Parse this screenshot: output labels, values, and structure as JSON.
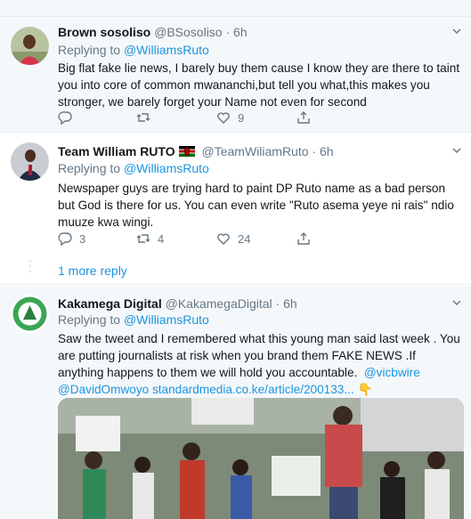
{
  "tweets": [
    {
      "name": "Brown sosoliso",
      "handle": "@BSosoliso",
      "separator": "·",
      "time": "6h",
      "replying_prefix": "Replying to",
      "replying_to": "@WilliamsRuto",
      "text": "Big flat fake lie news, I barely buy them cause I know they are there to taint you into core of common mwananchi,but tell you what,this makes you stronger, we barely forget your Name not even for second",
      "replies": "",
      "retweets": "",
      "likes": "9"
    },
    {
      "name": "Team William RUTO",
      "handle": "@TeamWiliamRuto",
      "separator": "·",
      "time": "6h",
      "replying_prefix": "Replying to",
      "replying_to": "@WilliamsRuto",
      "text": "Newspaper guys are trying hard to paint DP Ruto name as a bad person but God is there for us. You can even write \"Ruto asema yeye ni rais\" ndio muuze kwa wingi.",
      "replies": "3",
      "retweets": "4",
      "likes": "24",
      "more_replies": "1 more reply"
    },
    {
      "name": "Kakamega Digital",
      "handle": "@KakamegaDigital",
      "separator": "·",
      "time": "6h",
      "replying_prefix": "Replying to",
      "replying_to": "@WilliamsRuto",
      "text": "Saw the tweet and I remembered what this young man said last week . You are putting journalists at risk when you brand them FAKE NEWS .If anything happens to them we will hold you accountable.",
      "mention1": "@vicbwire",
      "mention2": "@DavidOmwoyo",
      "link": "standardmedia.co.ke/article/200133...",
      "emoji": "👇"
    }
  ],
  "colors": {
    "accent": "#1b95e0",
    "muted": "#657786",
    "bg_alt": "#f5f8fa"
  },
  "icons": [
    "reply-icon",
    "retweet-icon",
    "like-icon",
    "share-icon",
    "chevron-down-icon",
    "kenya-flag-icon"
  ]
}
